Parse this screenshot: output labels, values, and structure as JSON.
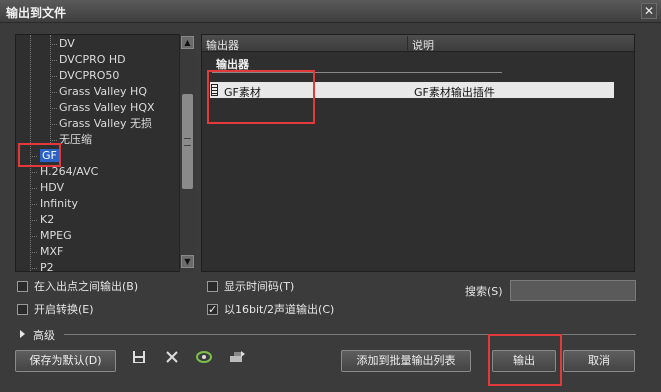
{
  "window": {
    "title": "输出到文件",
    "close_glyph": "✕"
  },
  "tree": {
    "children": [
      "DV",
      "DVCPRO HD",
      "DVCPRO50",
      "Grass Valley HQ",
      "Grass Valley HQX",
      "Grass Valley 无损",
      "无压缩"
    ],
    "items": [
      "GF",
      "H.264/AVC",
      "HDV",
      "Infinity",
      "K2",
      "MPEG",
      "MXF",
      "P2"
    ],
    "selected": "GF"
  },
  "output_panel": {
    "col_exporter": "输出器",
    "col_description": "说明",
    "group_label": "输出器",
    "rows": [
      {
        "name": "GF素材",
        "description": "GF素材输出插件",
        "icon": "film-strip-icon"
      }
    ]
  },
  "options": {
    "in_out_export": {
      "label": "在入出点之间输出(B)",
      "checked": false
    },
    "show_timecode": {
      "label": "显示时间码(T)",
      "checked": false
    },
    "enable_conversion": {
      "label": "开启转换(E)",
      "checked": false
    },
    "export_16bit": {
      "label": "以16bit/2声道输出(C)",
      "checked": true
    }
  },
  "search": {
    "label": "搜索(S)",
    "value": ""
  },
  "advanced": {
    "label": "高级"
  },
  "buttons": {
    "save_default": "保存为默认(D)",
    "add_batch": "添加到批量输出列表",
    "export": "输出",
    "cancel": "取消"
  },
  "icons": {
    "save": "save-icon",
    "delete": "delete-icon",
    "refresh": "refresh-icon",
    "settings": "settings-icon"
  },
  "colors": {
    "selection": "#2a62c6",
    "highlight_box": "#e23a3a",
    "background": "#3b3b3b"
  }
}
